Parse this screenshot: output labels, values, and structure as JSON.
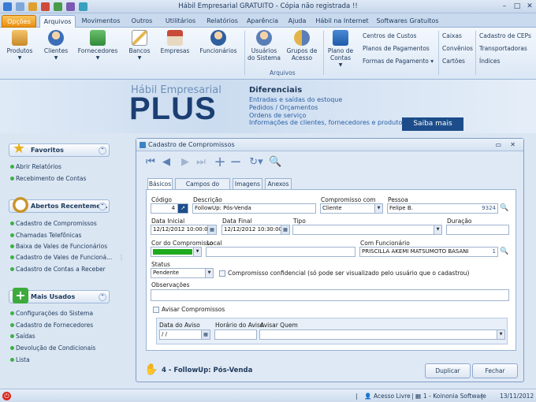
{
  "window": {
    "title": "Hábil Empresarial GRATUITO - Cópia não registrada !!"
  },
  "tabs": [
    "Opções",
    "Arquivos",
    "Movimentos",
    "Outros",
    "Utilitários",
    "Relatórios",
    "Aparência",
    "Ajuda",
    "Hábil na Internet",
    "Softwares Gratuitos"
  ],
  "ribbon": {
    "buttons": [
      "Produtos",
      "Clientes",
      "Fornecedores",
      "Bancos",
      "Empresas",
      "Funcionários",
      "Usuários do Sistema",
      "Grupos de Acesso",
      "Plano de Contas"
    ],
    "links_col1": [
      "Centros de Custos",
      "Planos de Pagamentos",
      "Formas de Pagamento"
    ],
    "links_col2": [
      "Caixas",
      "Convênios",
      "Cartões"
    ],
    "links_col3": [
      "Cadastro de CEPs",
      "Transportadoras",
      "Índices"
    ],
    "group_label": "Arquivos"
  },
  "banner": {
    "brand_top": "Hábil Empresarial",
    "brand_main": "PLUS",
    "heading": "Diferenciais",
    "features": [
      "Entradas e saídas do estoque",
      "Pedidos / Orçamentos",
      "Ordens de serviço",
      "Informações de clientes, fornecedores e produtos"
    ],
    "cta": "Saiba mais"
  },
  "sidebar": {
    "favoritos": {
      "title": "Favoritos",
      "items": [
        "Abrir Relatórios",
        "Recebimento de Contas"
      ]
    },
    "recentes": {
      "title": "Abertos Recenteme...",
      "items": [
        "Cadastro de Compromissos",
        "Chamadas Telefônicas",
        "Baixa de Vales de Funcionários",
        "Cadastro de Vales de Funcioná...",
        "Cadastro de Contas a Receber"
      ]
    },
    "mais_usados": {
      "title": "Mais Usados",
      "items": [
        "Configurações do Sistema",
        "Cadastro de Fornecedores",
        "Saídas",
        "Devolução de Condicionais",
        "Lista"
      ]
    }
  },
  "dialog": {
    "title": "Cadastro de Compromissos",
    "tabs": [
      "Básicos",
      "Campos do Usuário",
      "Imagens",
      "Anexos"
    ],
    "fields": {
      "codigo": {
        "label": "Código",
        "value": "4"
      },
      "descricao": {
        "label": "Descrição",
        "value": "FollowUp: Pós-Venda"
      },
      "compromisso_com": {
        "label": "Compromisso com",
        "value": "Cliente"
      },
      "pessoa": {
        "label": "Pessoa",
        "value": "Felipe B.",
        "code": "9324"
      },
      "data_inicial": {
        "label": "Data Inicial",
        "value": "12/12/2012 10:00:00"
      },
      "data_final": {
        "label": "Data Final",
        "value": "12/12/2012 10:30:00"
      },
      "tipo": {
        "label": "Tipo",
        "value": ""
      },
      "duracao": {
        "label": "Duração",
        "value": ""
      },
      "cor": {
        "label": "Cor do Compromisso",
        "color": "#1faa1f"
      },
      "local": {
        "label": "Local",
        "value": ""
      },
      "com_funcionario": {
        "label": "Com Funcionário",
        "value": "PRISCILLA  AKEMI MATSUMOTO BASANI",
        "code": "1"
      },
      "status": {
        "label": "Status",
        "value": "Pendente"
      },
      "confidencial": {
        "label": "Compromisso confidencial (só pode ser visualizado pelo usuário que o cadastrou)"
      },
      "observacoes": {
        "label": "Observações",
        "value": ""
      },
      "avisar": {
        "label": "Avisar Compromissos"
      },
      "data_aviso": {
        "label": "Data do Aviso",
        "value": " /  /"
      },
      "horario_aviso": {
        "label": "Horário do Aviso",
        "value": ""
      },
      "avisar_quem": {
        "label": "Avisar Quem",
        "value": ""
      }
    },
    "footer_label": "4 - FollowUp: Pós-Venda",
    "duplicar": "Duplicar",
    "fechar": "Fechar"
  },
  "statusbar": {
    "access": "Acesso Livre",
    "company": "1 - Koinonia Software",
    "date": "13/11/2012"
  }
}
